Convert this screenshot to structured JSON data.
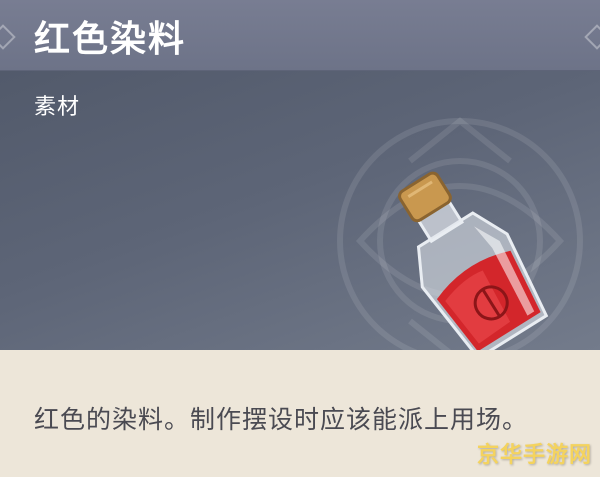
{
  "item": {
    "name": "红色染料",
    "category": "素材",
    "description": "红色的染料。制作摆设时应该能派上用场。",
    "icon": "red-dye-bottle-icon"
  },
  "watermark": "京华手游网",
  "colors": {
    "title_bar": "#6f758a",
    "header_bg": "#5a6274",
    "desc_bg": "#ede6d9",
    "desc_text": "#4a4a52",
    "dye_red": "#d3262b",
    "cork": "#c9984f"
  }
}
